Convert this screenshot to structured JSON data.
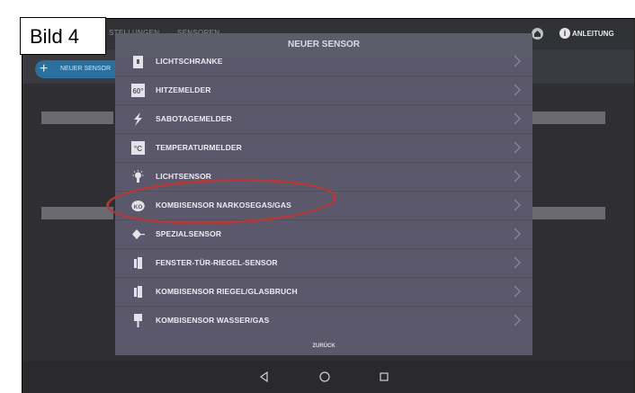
{
  "label": "Bild 4",
  "topbar": {
    "tabs": [
      "STELLUNGEN",
      "SENSOREN"
    ],
    "help_label": "ANLEITUNG",
    "icons": [
      "home-icon",
      "info-icon"
    ]
  },
  "subbar": {
    "new_sensor_button": "NEUER SENSOR"
  },
  "modal": {
    "title": "NEUER SENSOR",
    "items": [
      {
        "label": "LICHTSCHRANKE",
        "icon": "light-barrier-icon"
      },
      {
        "label": "HITZEMELDER",
        "icon": "heat-detector-icon",
        "icon_text": "60°"
      },
      {
        "label": "SABOTAGEMELDER",
        "icon": "sabotage-icon"
      },
      {
        "label": "TEMPERATURMELDER",
        "icon": "temperature-icon",
        "icon_text": "°C"
      },
      {
        "label": "LICHTSENSOR",
        "icon": "light-sensor-icon"
      },
      {
        "label": "KOMBISENSOR NARKOSEGAS/GAS",
        "icon": "gas-cloud-icon",
        "icon_text": "KO"
      },
      {
        "label": "SPEZIALSENSOR",
        "icon": "special-sensor-icon"
      },
      {
        "label": "FENSTER-TÜR-RIEGEL-SENSOR",
        "icon": "window-door-icon"
      },
      {
        "label": "KOMBISENSOR RIEGEL/GLASBRUCH",
        "icon": "bolt-glass-icon"
      },
      {
        "label": "KOMBISENSOR WASSER/GAS",
        "icon": "water-gas-icon"
      }
    ],
    "back_label": "ZURÜCK"
  },
  "navbar": {
    "icons": [
      "back-icon",
      "home-circle-icon",
      "recents-icon"
    ]
  },
  "colors": {
    "highlight_ellipse": "#b03a3a",
    "accent_button": "#2a6f9e"
  }
}
